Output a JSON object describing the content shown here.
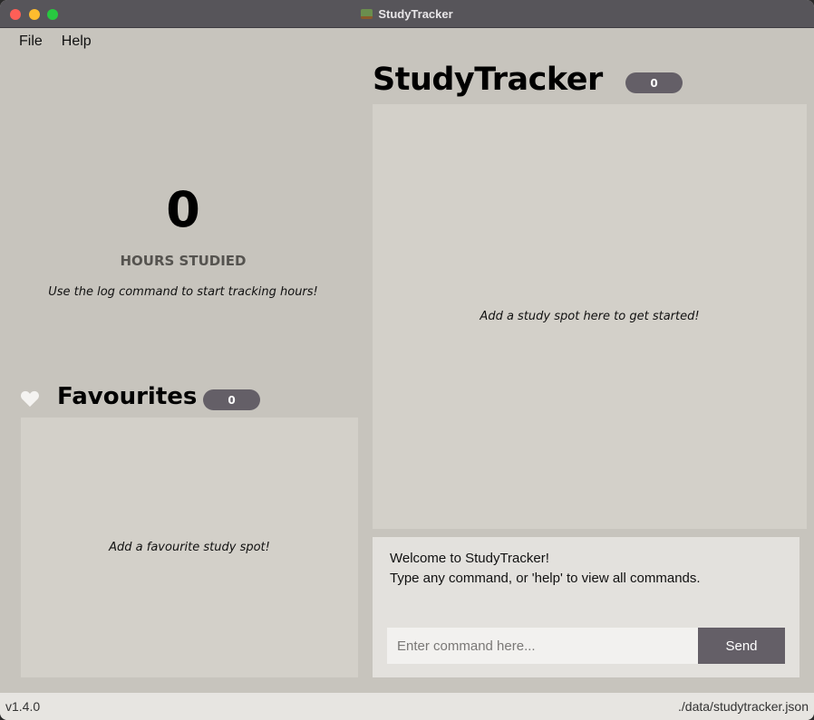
{
  "window": {
    "title": "StudyTracker"
  },
  "menu": {
    "items": [
      "File",
      "Help"
    ]
  },
  "hours": {
    "value": "0",
    "label": "HOURS STUDIED",
    "hint": "Use the log command to start tracking hours!"
  },
  "favourites": {
    "title": "Favourites",
    "count": "0",
    "empty_hint": "Add a favourite study spot!"
  },
  "main": {
    "title": "StudyTracker",
    "count": "0",
    "empty_hint": "Add a study spot here to get started!"
  },
  "command": {
    "welcome_line1": "Welcome to StudyTracker!",
    "welcome_line2": "Type any command, or 'help' to view all commands.",
    "placeholder": "Enter command here...",
    "send_label": "Send"
  },
  "status": {
    "version": "v1.4.0",
    "path": "./data/studytracker.json"
  },
  "colors": {
    "pill": "#645f67",
    "panel": "#d3d0c9",
    "background": "#c7c4bd"
  },
  "icons": {
    "favourites": "heart-icon",
    "app": "app-icon"
  }
}
